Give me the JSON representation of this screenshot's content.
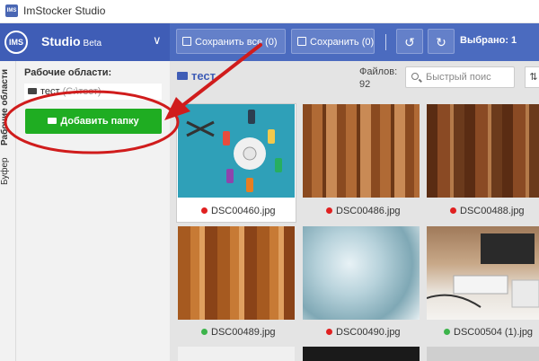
{
  "window": {
    "app_icon_text": "IMS",
    "title": "ImStocker Studio"
  },
  "brand": {
    "logo_text": "IMS",
    "name": "Studio",
    "badge": "Beta"
  },
  "toolbar": {
    "save_all_label": "Сохранить все (0)",
    "save_label": "Сохранить (0)",
    "selected_label": "Выбрано: 1"
  },
  "vertical_tabs": {
    "workspaces": "Рабочие области",
    "buffer": "Буфер"
  },
  "sidebar": {
    "title": "Рабочие области:",
    "workspace_name": "тест",
    "workspace_path": "(C:\\тест)",
    "add_folder_label": "Добавить папку"
  },
  "content": {
    "folder_name": "тест",
    "files_label": "Файлов:",
    "files_count": "92",
    "search_placeholder": "Быстрый поис",
    "images": [
      {
        "file": "DSC00460.jpg",
        "status": "red"
      },
      {
        "file": "DSC00486.jpg",
        "status": "red"
      },
      {
        "file": "DSC00488.jpg",
        "status": "red"
      },
      {
        "file": "DSC00489.jpg",
        "status": "green"
      },
      {
        "file": "DSC00490.jpg",
        "status": "red"
      },
      {
        "file": "DSC00504 (1).jpg",
        "status": "green"
      }
    ]
  },
  "colors": {
    "brand": "#3f5db6",
    "toolbar": "#4b6bbf",
    "add_button": "#1fad22",
    "status_red": "#e02020",
    "status_green": "#3cb44b",
    "annotation": "#d01c1c"
  },
  "icons": [
    "app-icon",
    "logo-icon",
    "chevron-down-icon",
    "save-all-icon",
    "save-icon",
    "undo-icon",
    "redo-icon",
    "folder-icon",
    "search-icon",
    "sort-icon"
  ]
}
